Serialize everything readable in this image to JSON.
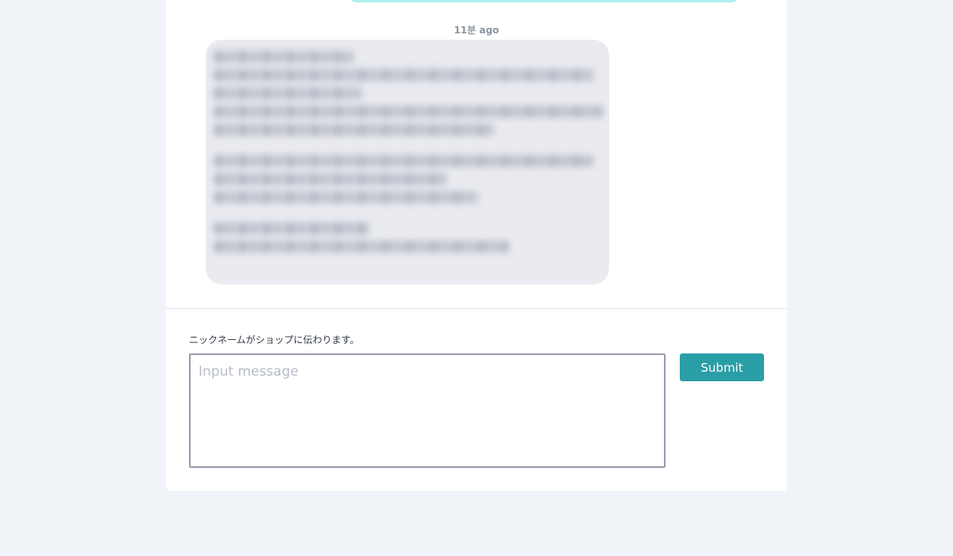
{
  "chat": {
    "timestamp": "11분 ago"
  },
  "composer": {
    "hint": "ニックネームがショップに伝わります。",
    "placeholder": "Input message",
    "value": "",
    "submit_label": "Submit"
  }
}
